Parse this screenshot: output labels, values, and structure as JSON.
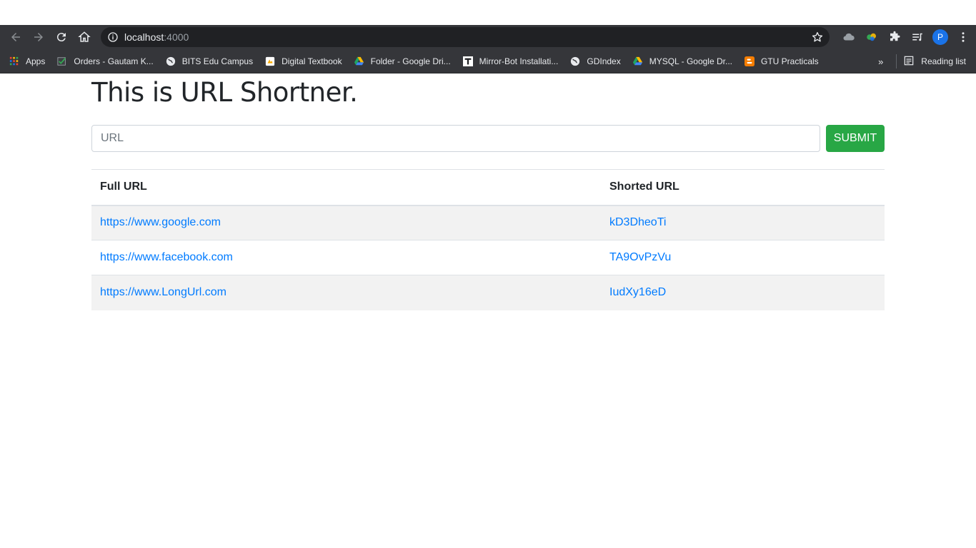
{
  "browser": {
    "address_host": "localhost",
    "address_port": ":4000",
    "profile_initial": "P",
    "bookmarks": [
      {
        "label": "Apps",
        "icon": "apps-grid-icon"
      },
      {
        "label": "Orders - Gautam K...",
        "icon": "checkmark-icon"
      },
      {
        "label": "BITS Edu Campus",
        "icon": "globe-icon"
      },
      {
        "label": "Digital Textbook",
        "icon": "textbook-icon"
      },
      {
        "label": "Folder - Google Dri...",
        "icon": "google-drive-icon"
      },
      {
        "label": "Mirror-Bot Installati...",
        "icon": "t-letter-icon"
      },
      {
        "label": "GDIndex",
        "icon": "globe-icon"
      },
      {
        "label": "MYSQL - Google Dr...",
        "icon": "google-drive-icon"
      },
      {
        "label": "GTU Practicals",
        "icon": "blogger-icon"
      }
    ],
    "overflow_label": "»",
    "reading_list_label": "Reading list"
  },
  "page": {
    "title": "This is URL Shortner.",
    "input_placeholder": "URL",
    "submit_label": "SUBMIT",
    "table": {
      "headers": [
        "Full URL",
        "Shorted URL"
      ],
      "rows": [
        {
          "full": "https://www.google.com",
          "short": "kD3DheoTi"
        },
        {
          "full": "https://www.facebook.com",
          "short": "TA9OvPzVu"
        },
        {
          "full": "https://www.LongUrl.com",
          "short": "IudXy16eD"
        }
      ]
    }
  },
  "colors": {
    "toolbar_bg": "#35363a",
    "omnibox_bg": "#202124",
    "submit_green": "#28a745",
    "link_blue": "#007bff"
  }
}
